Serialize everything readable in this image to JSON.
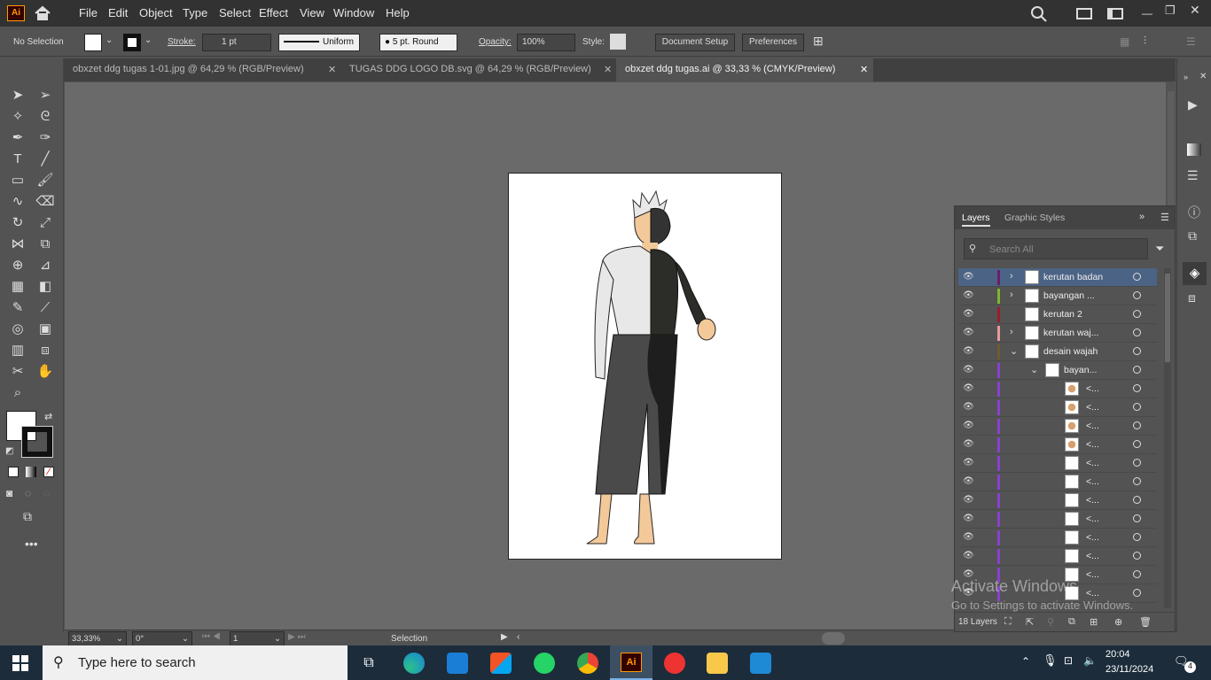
{
  "app": {
    "logo": "Ai"
  },
  "menu": [
    "File",
    "Edit",
    "Object",
    "Type",
    "Select",
    "Effect",
    "View",
    "Window",
    "Help"
  ],
  "control": {
    "selection": "No Selection",
    "stroke_label": "Stroke:",
    "stroke_value": "1 pt",
    "profile": "Uniform",
    "brush": "5 pt. Round",
    "opacity_label": "Opacity:",
    "opacity_value": "100%",
    "style_label": "Style:",
    "doc_setup": "Document Setup",
    "preferences": "Preferences"
  },
  "tabs": [
    {
      "label": "obxzet ddg tugas 1-01.jpg @ 64,29 % (RGB/Preview)"
    },
    {
      "label": "TUGAS DDG LOGO DB.svg @ 64,29 % (RGB/Preview)"
    },
    {
      "label": "obxzet ddg tugas.ai @ 33,33 % (CMYK/Preview)"
    }
  ],
  "status": {
    "zoom": "33,33%",
    "rotate": "0°",
    "artboard": "1",
    "tool": "Selection"
  },
  "layers_panel": {
    "tab_layers": "Layers",
    "tab_graphic_styles": "Graphic Styles",
    "search_placeholder": "Search All",
    "count": "18 Layers",
    "rows": [
      {
        "name": "kerutan badan",
        "color": "#6b1e6b"
      },
      {
        "name": "bayangan ...",
        "color": "#7ab92e"
      },
      {
        "name": "kerutan 2",
        "color": "#9b1c2a"
      },
      {
        "name": "kerutan waj...",
        "color": "#e79a9a"
      },
      {
        "name": "desain wajah",
        "color": "#6f5b2c"
      },
      {
        "name": "bayan...",
        "color": "#8b3fd0"
      },
      {
        "name": "<...",
        "color": "#8b3fd0"
      },
      {
        "name": "<...",
        "color": "#8b3fd0"
      },
      {
        "name": "<...",
        "color": "#8b3fd0"
      },
      {
        "name": "<...",
        "color": "#8b3fd0"
      },
      {
        "name": "<...",
        "color": "#8b3fd0"
      },
      {
        "name": "<...",
        "color": "#8b3fd0"
      },
      {
        "name": "<...",
        "color": "#8b3fd0"
      },
      {
        "name": "<...",
        "color": "#8b3fd0"
      },
      {
        "name": "<...",
        "color": "#8b3fd0"
      },
      {
        "name": "<...",
        "color": "#8b3fd0"
      },
      {
        "name": "<...",
        "color": "#8b3fd0"
      },
      {
        "name": "<...",
        "color": "#8b3fd0"
      }
    ]
  },
  "watermark": {
    "line1": "Activate Windows",
    "line2": "Go to Settings to activate Windows."
  },
  "taskbar": {
    "search_placeholder": "Type here to search",
    "time": "20:04",
    "date": "23/11/2024",
    "notif": "4"
  }
}
